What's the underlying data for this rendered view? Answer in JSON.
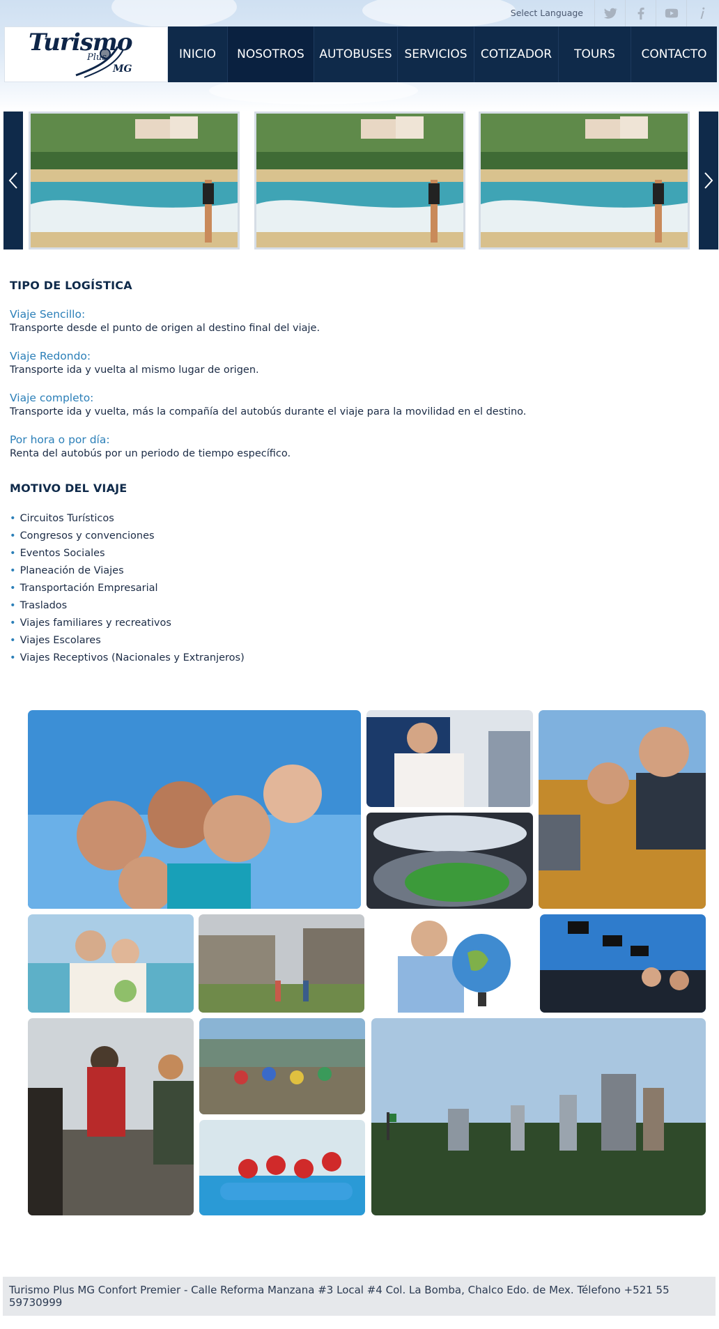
{
  "topbar": {
    "language_label": "Select Language",
    "social": [
      {
        "icon": "twitter-icon"
      },
      {
        "icon": "facebook-icon"
      },
      {
        "icon": "youtube-icon"
      },
      {
        "icon": "info-icon"
      }
    ]
  },
  "brand": {
    "logo_main": "Turismo",
    "logo_sub": "Plus",
    "logo_mg": "MG"
  },
  "nav": {
    "items": [
      "INICIO",
      "NOSOTROS",
      "AUTOBUSES",
      "SERVICIOS",
      "COTIZADOR",
      "TOURS",
      "CONTACTO"
    ],
    "active_index": 1
  },
  "carousel": {
    "slides": 3,
    "prev_icon": "chevron-left-icon",
    "next_icon": "chevron-right-icon"
  },
  "logistica": {
    "title": "TIPO DE LOGÍSTICA",
    "items": [
      {
        "term": "Viaje Sencillo:",
        "desc": "Transporte desde el punto de origen al destino final del viaje."
      },
      {
        "term": "Viaje Redondo:",
        "desc": "Transporte ida y vuelta al mismo lugar de origen."
      },
      {
        "term": "Viaje completo:",
        "desc": "Transporte ida y vuelta, más la compañía del autobús durante el viaje para la movilidad en el destino."
      },
      {
        "term": "Por hora o por día:",
        "desc": "Renta del autobús por un periodo de tiempo específico."
      }
    ]
  },
  "motivo": {
    "title": "MOTIVO DEL VIAJE",
    "bullet": "•",
    "items": [
      "Circuitos Turísticos",
      "Congresos y convenciones",
      "Eventos Sociales",
      "Planeación de Viajes",
      "Transportación Empresarial",
      "Traslados",
      "Viajes familiares y recreativos",
      "Viajes Escolares",
      "Viajes Receptivos (Nacionales y Extranjeros)"
    ]
  },
  "footer": {
    "text": "Turismo Plus MG Confort Premier - Calle Reforma Manzana #3 Local #4 Col. La Bomba, Chalco Edo. de Mex. Télefono +521 55 59730999"
  },
  "colors": {
    "nav_bg": "#0f2a4a",
    "accent": "#2b7fb8",
    "title": "#0f2a4a",
    "footer_bg": "#e6e8eb"
  }
}
